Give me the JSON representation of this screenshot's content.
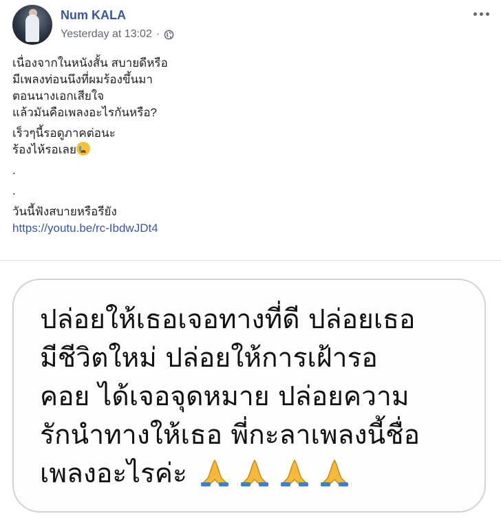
{
  "post": {
    "author": "Num KALA",
    "timestamp": "Yesterday at 13:02",
    "separator": "·",
    "privacy_icon": "globe-icon",
    "more_icon": "more-options-icon",
    "text_blocks": {
      "p1_l1": "เนื่องจากในหนังสั้น สบายดีหรือ",
      "p1_l2": "มีเพลงท่อนนึงที่ผมร้องขึ้นมา",
      "p1_l3": "ตอนนางเอกเสียใจ",
      "p1_l4": "แล้วมันคือเพลงอะไรกันหรือ?",
      "p2_l1": "เร็วๆนี้รอดูภาคต่อนะ",
      "p2_l2": "ร้องไห้รอเลย",
      "dot1": ".",
      "dot2": ".",
      "p3_l1": "วันนี้ฟังสบายหรือรียัง",
      "link": "https://youtu.be/rc-IbdwJDt4"
    },
    "emoji_cry": "crying-face-icon"
  },
  "image": {
    "lines": [
      "ปล่อยให้เธอเจอทางที่ดี ปล่อยเธอ",
      "มีชีวิตใหม่ ปล่อยให้การเฝ้ารอ",
      "คอย ได้เจอจุดหมาย ปล่อยความ",
      "รักนำทางให้เธอ พี่กะลาเพลงนี้ชื่อ",
      "เพลงอะไรค่ะ"
    ],
    "emoji_icon": "folded-hands-icon",
    "emoji_count": 4
  },
  "colors": {
    "author": "#385898",
    "link": "#385898",
    "meta": "#616770",
    "divider": "#dddfe2"
  }
}
